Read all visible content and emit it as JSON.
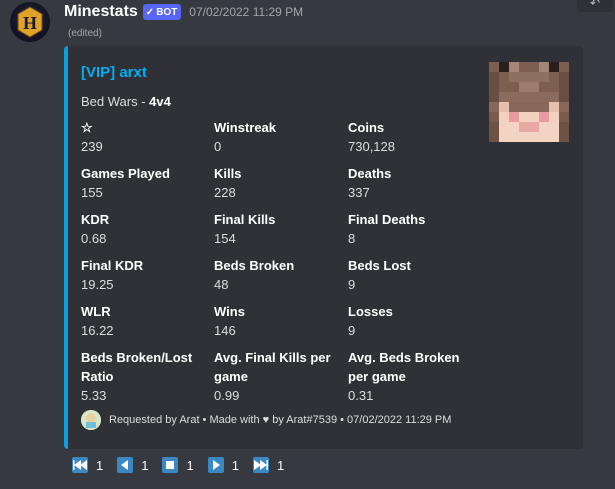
{
  "message": {
    "username": "Minestats",
    "bot_tag": "BOT",
    "timestamp": "07/02/2022 11:29 PM",
    "edited": "(edited)"
  },
  "embed": {
    "title": "[VIP] arxt",
    "description_prefix": "Bed Wars - ",
    "description_mode": "4v4",
    "accent_color": "#0d9fe6",
    "fields": [
      {
        "name": "☆",
        "value": "239"
      },
      {
        "name": "Winstreak",
        "value": "0"
      },
      {
        "name": "Coins",
        "value": "730,128"
      },
      {
        "name": "Games Played",
        "value": "155"
      },
      {
        "name": "Kills",
        "value": "228"
      },
      {
        "name": "Deaths",
        "value": "337"
      },
      {
        "name": "KDR",
        "value": "0.68"
      },
      {
        "name": "Final Kills",
        "value": "154"
      },
      {
        "name": "Final Deaths",
        "value": "8"
      },
      {
        "name": "Final KDR",
        "value": "19.25"
      },
      {
        "name": "Beds Broken",
        "value": "48"
      },
      {
        "name": "Beds Lost",
        "value": "9"
      },
      {
        "name": "WLR",
        "value": "16.22"
      },
      {
        "name": "Wins",
        "value": "146"
      },
      {
        "name": "Losses",
        "value": "9"
      },
      {
        "name": "Beds Broken/Lost Ratio",
        "value": "5.33"
      },
      {
        "name": "Avg. Final Kills per game",
        "value": "0.99"
      },
      {
        "name": "Avg. Beds Broken per game",
        "value": "0.31"
      }
    ],
    "footer": "Requested by Arat • Made with ♥ by Arat#7539 • 07/02/2022 11:29 PM"
  },
  "buttons": [
    {
      "icon": "first-page-icon",
      "label": "1"
    },
    {
      "icon": "previous-page-icon",
      "label": "1"
    },
    {
      "icon": "stop-icon",
      "label": "1"
    },
    {
      "icon": "next-page-icon",
      "label": "1"
    },
    {
      "icon": "last-page-icon",
      "label": "1"
    }
  ]
}
